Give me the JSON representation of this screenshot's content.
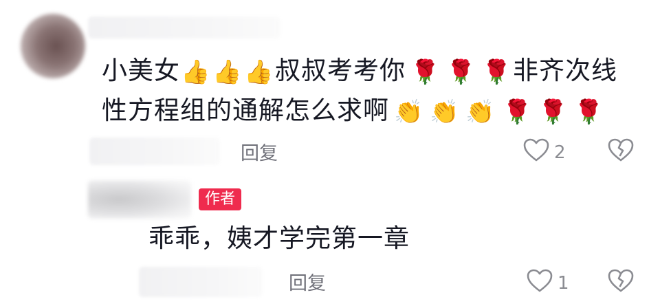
{
  "comment": {
    "text_line1_a": "小美女",
    "text_line1_b": "叔叔考考你",
    "text_line1_c": "非齐次线",
    "text_line2_a": "性方程组的通解怎么求啊",
    "emoji": {
      "thumbs_up": "👍",
      "clap": "👏",
      "rose": "🌹"
    },
    "reply_label": "回复",
    "like_count": "2"
  },
  "reply": {
    "author_badge": "作者",
    "text": "乖乖，姨才学完第一章",
    "reply_label": "回复",
    "like_count": "1"
  },
  "colors": {
    "badge": "#ef2b4e",
    "text": "#161823",
    "muted": "#8a8b91"
  }
}
